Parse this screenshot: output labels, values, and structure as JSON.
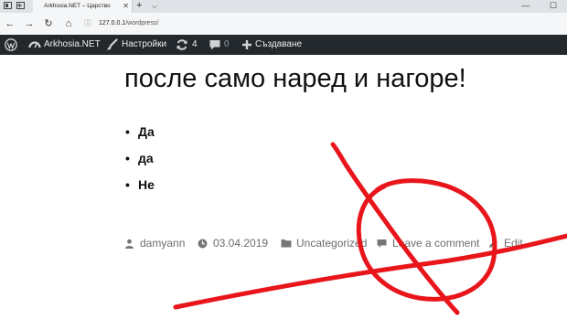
{
  "browser": {
    "tab_title": "Arkhosia.NET – Царство",
    "tab_close": "✕",
    "new_tab": "+",
    "tab_menu": "⌵",
    "minimize": "—",
    "maximize": "☐",
    "back": "←",
    "forward": "→",
    "refresh": "↻",
    "home": "⌂",
    "url_info": "ⓘ",
    "url_host": "127.0.0.1",
    "url_path": "/wordpress/"
  },
  "adminbar": {
    "site_name": "Arkhosia.NET",
    "customize": "Настройки",
    "updates_count": "4",
    "comments_count": "0",
    "new_label": "Създаване"
  },
  "post": {
    "heading": "после само наред и нагоре!",
    "bullet": "•",
    "items": [
      "Да",
      "да",
      "Не"
    ],
    "meta": {
      "author": "damyann",
      "date": "03.04.2019",
      "category": "Uncategorized",
      "comment": "Leave a comment",
      "edit": "Edit"
    }
  },
  "annotation": {
    "color": "#e8151b"
  }
}
